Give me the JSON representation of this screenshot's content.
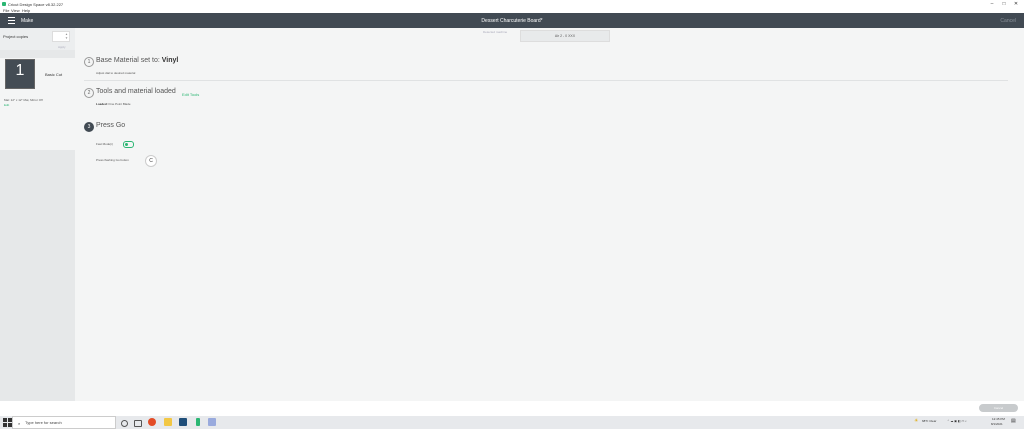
{
  "window": {
    "title": "Cricut Design Space  v8.32.227",
    "minimize": "–",
    "maximize": "□",
    "close": "✕"
  },
  "menu": [
    "File",
    "View",
    "Help"
  ],
  "header": {
    "left": "Make",
    "title": "Dessert Charcuterie Board*",
    "right": "Cancel"
  },
  "sidebar": {
    "project_copies_label": "Project copies",
    "project_copies_value": "",
    "apply_label": "Apply",
    "mat": {
      "number": "1",
      "label": "Basic Cut",
      "size": "Mat: 12\" x 12\" Mat, Mirror Off",
      "edit": "Edit"
    }
  },
  "device": {
    "label": "Detected machine",
    "value": "Air 2 - 0 XXX"
  },
  "steps": [
    {
      "number": "1",
      "title_prefix": "Base Material set to:",
      "title_value": "Vinyl",
      "subtitle": "Adjust dial to desired material"
    },
    {
      "number": "2",
      "title": "Tools and material loaded",
      "edit_tools": "Edit Tools",
      "loaded_label": "Loaded:",
      "loaded_value": "Fine Point Blade"
    },
    {
      "number": "3",
      "title": "Press Go",
      "fast_mode": "Fast Mode(i)",
      "press_go": "Press flashing Go button",
      "go_glyph": "C"
    }
  ],
  "footer": {
    "cancel_button": "Cancel"
  },
  "taskbar": {
    "search_placeholder": "Type here for search",
    "weather": "68°F Clear",
    "time": "12:45 PM",
    "date": "8/1/2021"
  },
  "colors": {
    "accent": "#2bb673",
    "header": "#414a53"
  }
}
